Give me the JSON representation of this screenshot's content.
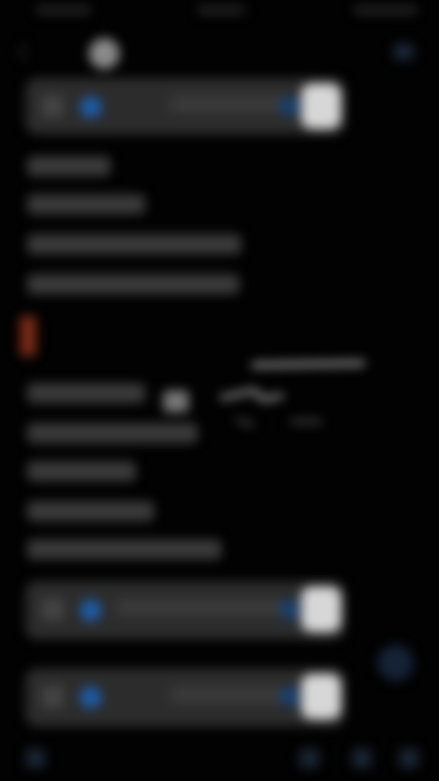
{
  "status_bar": {
    "time": "",
    "carrier": "",
    "battery": ""
  },
  "header": {
    "title": "",
    "icons": {
      "back": "chevron-left-icon",
      "action": "more-icon"
    }
  },
  "cards": [
    {
      "name": "media-card-top",
      "text": "",
      "icon": "attachment-icon"
    },
    {
      "name": "media-card-middle",
      "text": "",
      "icon": "attachment-icon"
    },
    {
      "name": "media-card-bottom",
      "text": "",
      "icon": "attachment-icon"
    }
  ],
  "messages": [
    {
      "text": ""
    },
    {
      "text": ""
    },
    {
      "text": ""
    },
    {
      "text": ""
    },
    {
      "text": ""
    },
    {
      "text": ""
    },
    {
      "text": ""
    },
    {
      "text": ""
    },
    {
      "text": ""
    },
    {
      "text": ""
    }
  ],
  "colors": {
    "background": "#020202",
    "card": "#2c2c2c",
    "accent_blue": "#1d5ca8",
    "accent_red": "#7a2a18"
  }
}
